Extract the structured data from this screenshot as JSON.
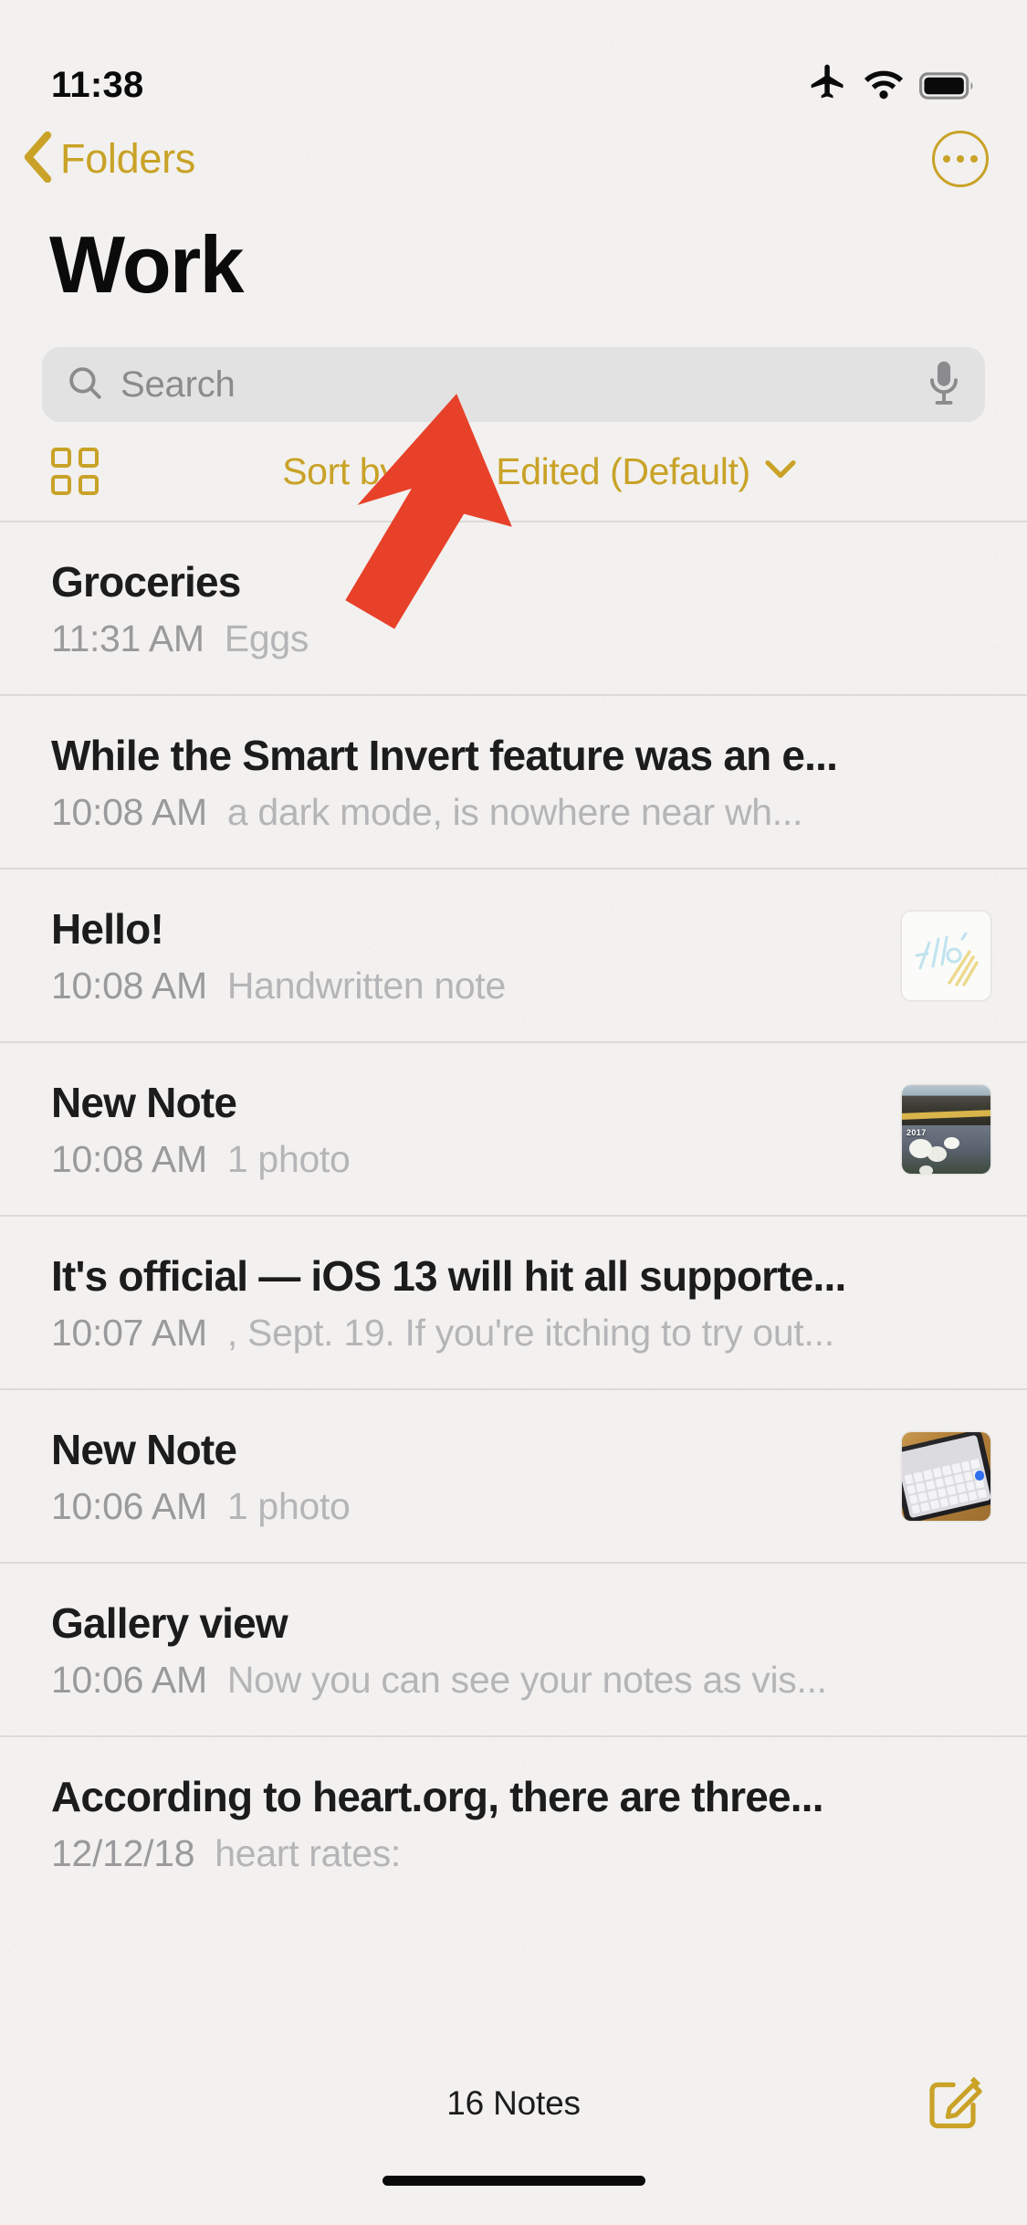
{
  "status_bar": {
    "time": "11:38",
    "icons": [
      "airplane-mode-icon",
      "wifi-icon",
      "battery-icon"
    ]
  },
  "nav": {
    "back_label": "Folders",
    "back_icon": "chevron-left-icon",
    "more_icon": "ellipsis-circle-icon"
  },
  "header": {
    "title": "Work"
  },
  "search": {
    "placeholder": "Search",
    "value": "",
    "search_icon": "magnifying-glass-icon",
    "mic_icon": "microphone-icon"
  },
  "sort": {
    "gallery_icon": "grid-view-icon",
    "label": "Sort by Date Edited (Default)",
    "chevron_icon": "chevron-down-icon"
  },
  "notes": [
    {
      "title": "Groceries",
      "date": "11:31 AM",
      "snippet": "Eggs",
      "thumb": "none"
    },
    {
      "title": "While the Smart Invert feature was an e...",
      "date": "10:08 AM",
      "snippet": "a dark mode, is nowhere near wh...",
      "thumb": "none"
    },
    {
      "title": "Hello!",
      "date": "10:08 AM",
      "snippet": "Handwritten note",
      "thumb": "handwriting"
    },
    {
      "title": "New Note",
      "date": "10:08 AM",
      "snippet": "1 photo",
      "thumb": "photo-road-flowers",
      "thumb_label": "2017"
    },
    {
      "title": "It's official — iOS 13 will hit all supporte...",
      "date": "10:07 AM",
      "snippet": ", Sept. 19. If you're itching to try out...",
      "thumb": "none"
    },
    {
      "title": "New Note",
      "date": "10:06 AM",
      "snippet": "1 photo",
      "thumb": "photo-phone-keyboard"
    },
    {
      "title": "Gallery view",
      "date": "10:06 AM",
      "snippet": "Now you can see your notes as vis...",
      "thumb": "none"
    },
    {
      "title": "According to heart.org, there are three...",
      "date": "12/12/18",
      "snippet": "heart rates:",
      "thumb": "none"
    }
  ],
  "toolbar": {
    "notes_count": "16 Notes",
    "compose_icon": "compose-note-icon"
  },
  "annotation": {
    "type": "arrow",
    "color": "#E8412A",
    "points_to": "sort-by-date-edited-button"
  },
  "colors": {
    "accent_gold": "#C9A227",
    "background": "#F2F1EF",
    "title_text": "#1C1C1C",
    "secondary_text": "#9A9A9C",
    "snippet_text": "#B5B5B7",
    "separator": "#DCDBD8",
    "annotation_red": "#E8412A"
  }
}
